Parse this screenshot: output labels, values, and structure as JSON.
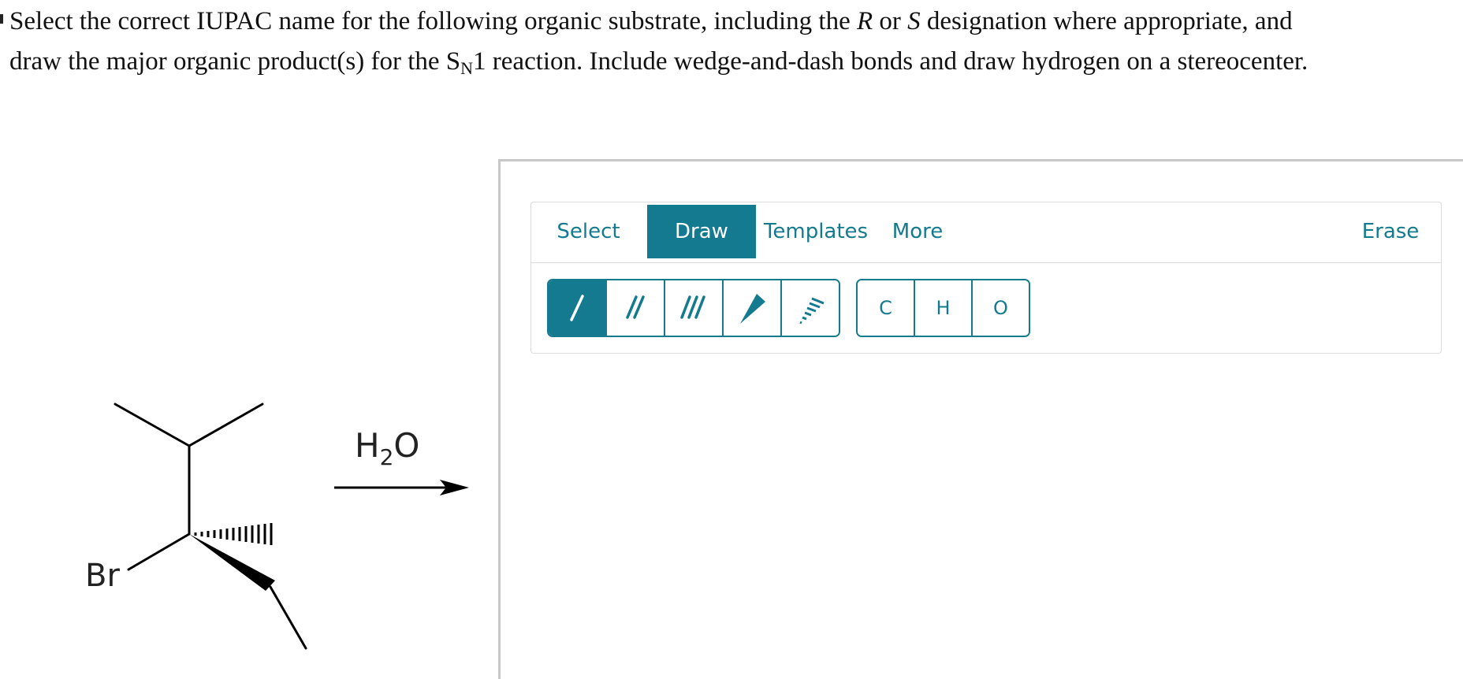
{
  "question": {
    "line1_a": "Select the correct IUPAC name for the following organic substrate, including the ",
    "r": "R",
    "or": " or ",
    "s": "S",
    "line1_b": " designation where appropriate, and",
    "line2_a": "draw the major organic product(s) for the S",
    "sub_n": "N",
    "line2_b": "1 reaction. Include wedge-and-dash bonds and draw hydrogen on a stereocenter."
  },
  "substrate": {
    "leaving_group": "Br",
    "reagent_main": "H",
    "reagent_sub": "2",
    "reagent_tail": "O"
  },
  "toolbar": {
    "tabs": [
      "Select",
      "Draw",
      "Templates",
      "More"
    ],
    "active_tab": "Draw",
    "erase_label": "Erase",
    "bond_tools": [
      "single-bond",
      "double-bond",
      "triple-bond",
      "wedge-bond",
      "dash-bond"
    ],
    "active_bond": "single-bond",
    "atoms": [
      "C",
      "H",
      "O"
    ]
  },
  "colors": {
    "accent": "#137a8f",
    "border": "#dcdcdc",
    "panel_border": "#c8c8c8"
  }
}
